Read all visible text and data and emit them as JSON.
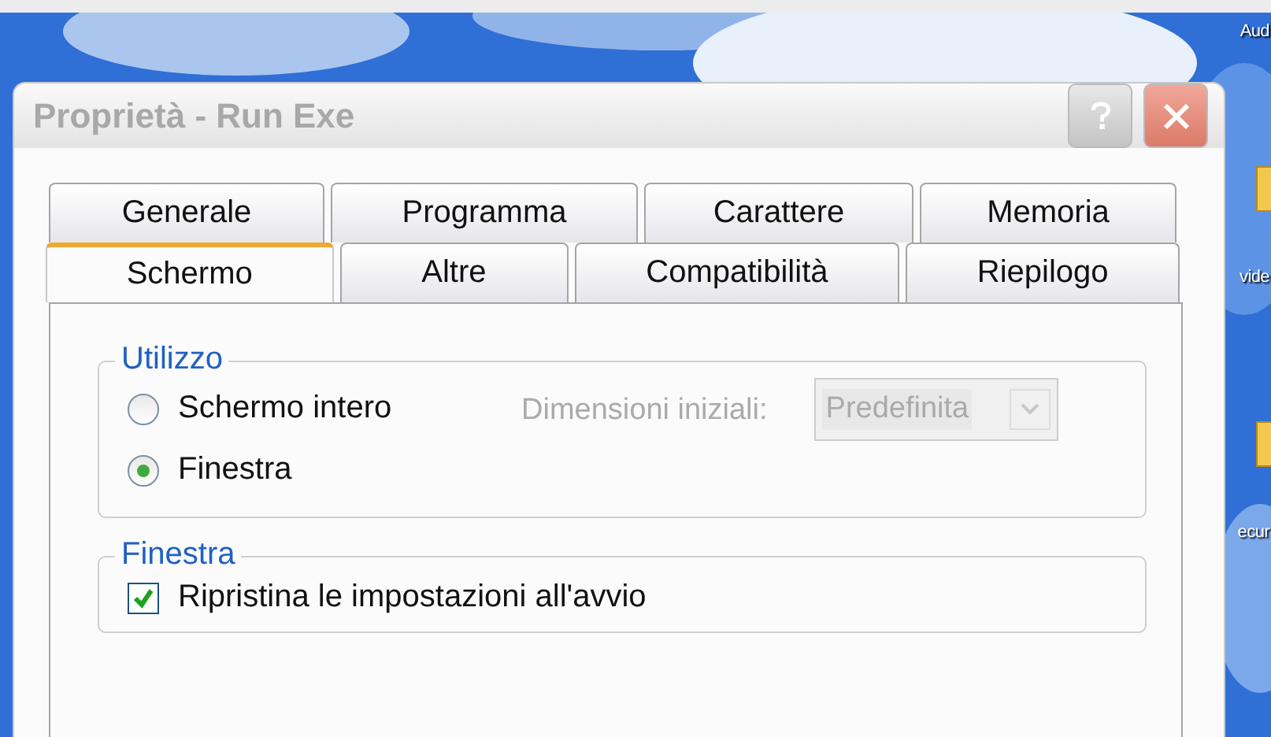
{
  "desktop": {
    "icons": [
      {
        "label": "Aud",
        "kind": "label"
      },
      {
        "label": "vide",
        "kind": "folder"
      },
      {
        "label": "ecur",
        "kind": "folder"
      }
    ]
  },
  "window": {
    "title": "Proprietà - Run Exe",
    "active": false,
    "tab_rows": [
      [
        {
          "label": "Generale",
          "selected": false
        },
        {
          "label": "Programma",
          "selected": false
        },
        {
          "label": "Carattere",
          "selected": false
        },
        {
          "label": "Memoria",
          "selected": false
        }
      ],
      [
        {
          "label": "Schermo",
          "selected": true
        },
        {
          "label": "Altre",
          "selected": false
        },
        {
          "label": "Compatibilità",
          "selected": false
        },
        {
          "label": "Riepilogo",
          "selected": false
        }
      ]
    ],
    "groups": [
      {
        "title": "Utilizzo",
        "kind": "usage",
        "options": [
          {
            "label": "Schermo intero",
            "selected": false
          },
          {
            "label": "Finestra",
            "selected": true
          }
        ],
        "size_label": "Dimensioni iniziali:",
        "size_value": "Predefinita",
        "size_disabled": true
      },
      {
        "title": "Finestra",
        "kind": "window",
        "checks": [
          {
            "label": "Ripristina le impostazioni all'avvio",
            "checked": true
          }
        ]
      }
    ]
  }
}
